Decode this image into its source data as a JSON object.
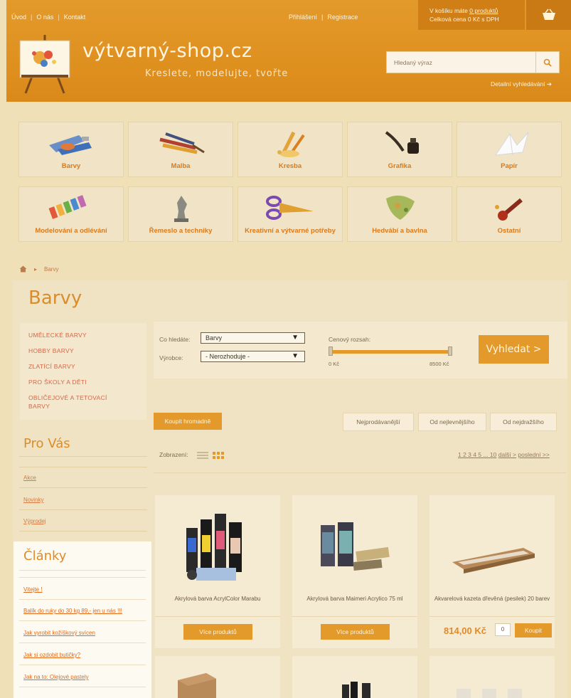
{
  "header": {
    "topnav": [
      "Úvod",
      "O nás",
      "Kontakt"
    ],
    "login": "Přihlášení",
    "register": "Registrace",
    "cart_line1_prefix": "V košíku máte",
    "cart_line1_link": "0 produktů",
    "cart_line2": "Celková cena 0 Kč s DPH",
    "logo_title": "výtvarný-shop.cz",
    "logo_subtitle": "Kreslete, modelujte, tvořte",
    "search_placeholder": "Hledaný výraz",
    "advanced_search": "Detailní vyhledávání"
  },
  "categories": [
    {
      "label": "Barvy",
      "icon": "paint-tubes-icon"
    },
    {
      "label": "Malba",
      "icon": "brushes-icon"
    },
    {
      "label": "Kresba",
      "icon": "pencils-icon"
    },
    {
      "label": "Grafika",
      "icon": "ink-quill-icon"
    },
    {
      "label": "Papír",
      "icon": "origami-icon"
    },
    {
      "label": "Modelování a odlévání",
      "icon": "plasticine-icon"
    },
    {
      "label": "Řemeslo a techniky",
      "icon": "chess-knight-icon"
    },
    {
      "label": "Kreativní a výtvarné potřeby",
      "icon": "scissors-icon"
    },
    {
      "label": "Hedvábí a bavlna",
      "icon": "silk-scarf-icon"
    },
    {
      "label": "Ostatní",
      "icon": "wax-seal-icon"
    }
  ],
  "breadcrumb": {
    "current": "Barvy"
  },
  "page_title": "Barvy",
  "left_menu": [
    "UMĚLECKÉ BARVY",
    "HOBBY BARVY",
    "ZLATÍCÍ BARVY",
    "PRO ŠKOLY A DĚTI",
    "OBLIČEJOVÉ A TETOVACÍ",
    "BARVY"
  ],
  "pro_vas": {
    "title": "Pro Vás",
    "links": [
      "Akce",
      "Novinky",
      "Výprodej"
    ]
  },
  "clanky": {
    "title": "Články",
    "links": [
      "Vitejte !",
      "Balík do ruky do 30 kg 89,- jen u nás !!!",
      "Jak vyrobit kožíškový svícen",
      "Jak si ozdobit butičky?",
      "Jak na to: Olejové pastely"
    ]
  },
  "filter": {
    "category_label": "Co hledáte:",
    "category_value": "Barvy",
    "maker_label": "Výrobce:",
    "maker_value": "- Nerozhoduje -",
    "price_label": "Cenový rozsah:",
    "price_min": "0 Kč",
    "price_max": "8500 Kč",
    "search_button": "Vyhledat >"
  },
  "bulk_buy": "Koupit hromadně",
  "sort": [
    "Nejprodávanější",
    "Od nejlevnějšího",
    "Od nejdražšího"
  ],
  "view_label": "Zobrazení:",
  "pager": {
    "pages": "1 2 3 4 5 ... 10",
    "next": "další >",
    "last": "poslední >>"
  },
  "products": [
    {
      "name": "Akrylová barva AcrylColor Marabu",
      "button": "Více produktů"
    },
    {
      "name": "Akrylová barva Maimeri Acrylico 75 ml",
      "button": "Více produktů"
    },
    {
      "name": "Akvarelová kazeta dřevěná (pesilek) 20 barev",
      "price": "814,00 Kč",
      "qty": "0",
      "buy": "Koupit"
    }
  ]
}
